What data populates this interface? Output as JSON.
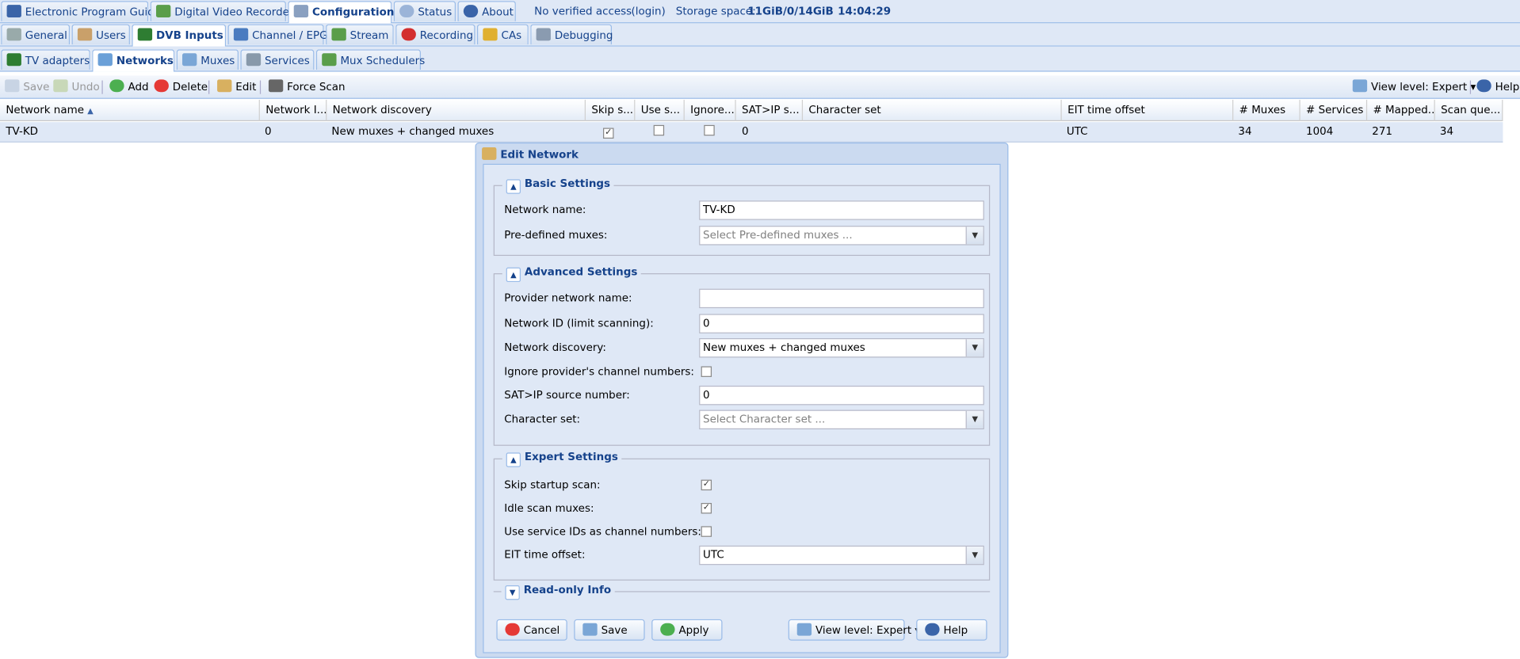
{
  "top_tabs": [
    "Electronic Program Guide",
    "Digital Video Recorder",
    "Configuration",
    "Status",
    "About"
  ],
  "status_info": {
    "access": "No verified access",
    "login": "(login)",
    "storage_label": "Storage space:",
    "storage_value": "11GiB/0/14GiB",
    "time": "14:04:29"
  },
  "config_tabs": [
    "General",
    "Users",
    "DVB Inputs",
    "Channel / EPG",
    "Stream",
    "Recording",
    "CAs",
    "Debugging"
  ],
  "dvb_tabs": [
    "TV adapters",
    "Networks",
    "Muxes",
    "Services",
    "Mux Schedulers"
  ],
  "toolbar": {
    "save": "Save",
    "undo": "Undo",
    "add": "Add",
    "delete": "Delete",
    "edit": "Edit",
    "force_scan": "Force Scan",
    "view_level": "View level: Expert",
    "help": "Help"
  },
  "grid": {
    "columns": [
      "Network name",
      "Network I...",
      "Network discovery",
      "Skip s...",
      "Use s...",
      "Ignore...",
      "SAT>IP s...",
      "Character set",
      "EIT time offset",
      "# Muxes",
      "# Services",
      "# Mapped...",
      "Scan que..."
    ],
    "row": {
      "name": "TV-KD",
      "network_id": "0",
      "discovery": "New muxes + changed muxes",
      "skip_startup": true,
      "use_sid": false,
      "ignore_numbers": false,
      "satip": "0",
      "charset": "",
      "eit_offset": "UTC",
      "muxes": "34",
      "services": "1004",
      "mapped": "271",
      "scan_queue": "34"
    }
  },
  "dialog": {
    "title": "Edit Network",
    "basic": {
      "legend": "Basic Settings",
      "network_name_label": "Network name:",
      "network_name_value": "TV-KD",
      "predefined_label": "Pre-defined muxes:",
      "predefined_placeholder": "Select Pre-defined muxes ..."
    },
    "advanced": {
      "legend": "Advanced Settings",
      "provider_label": "Provider network name:",
      "provider_value": "",
      "netid_label": "Network ID (limit scanning):",
      "netid_value": "0",
      "discovery_label": "Network discovery:",
      "discovery_value": "New muxes + changed muxes",
      "ignore_label": "Ignore provider's channel numbers:",
      "ignore_checked": false,
      "satip_label": "SAT>IP source number:",
      "satip_value": "0",
      "charset_label": "Character set:",
      "charset_placeholder": "Select Character set ..."
    },
    "expert": {
      "legend": "Expert Settings",
      "skip_label": "Skip startup scan:",
      "skip_checked": true,
      "idle_label": "Idle scan muxes:",
      "idle_checked": true,
      "useid_label": "Use service IDs as channel numbers:",
      "useid_checked": false,
      "eit_label": "EIT time offset:",
      "eit_value": "UTC"
    },
    "readonly": {
      "legend": "Read-only Info"
    },
    "buttons": {
      "cancel": "Cancel",
      "save": "Save",
      "apply": "Apply",
      "view_level": "View level: Expert",
      "help": "Help"
    }
  },
  "colors": {
    "accent": "#15428b",
    "panel": "#dfe8f6",
    "border": "#99bbe8"
  }
}
